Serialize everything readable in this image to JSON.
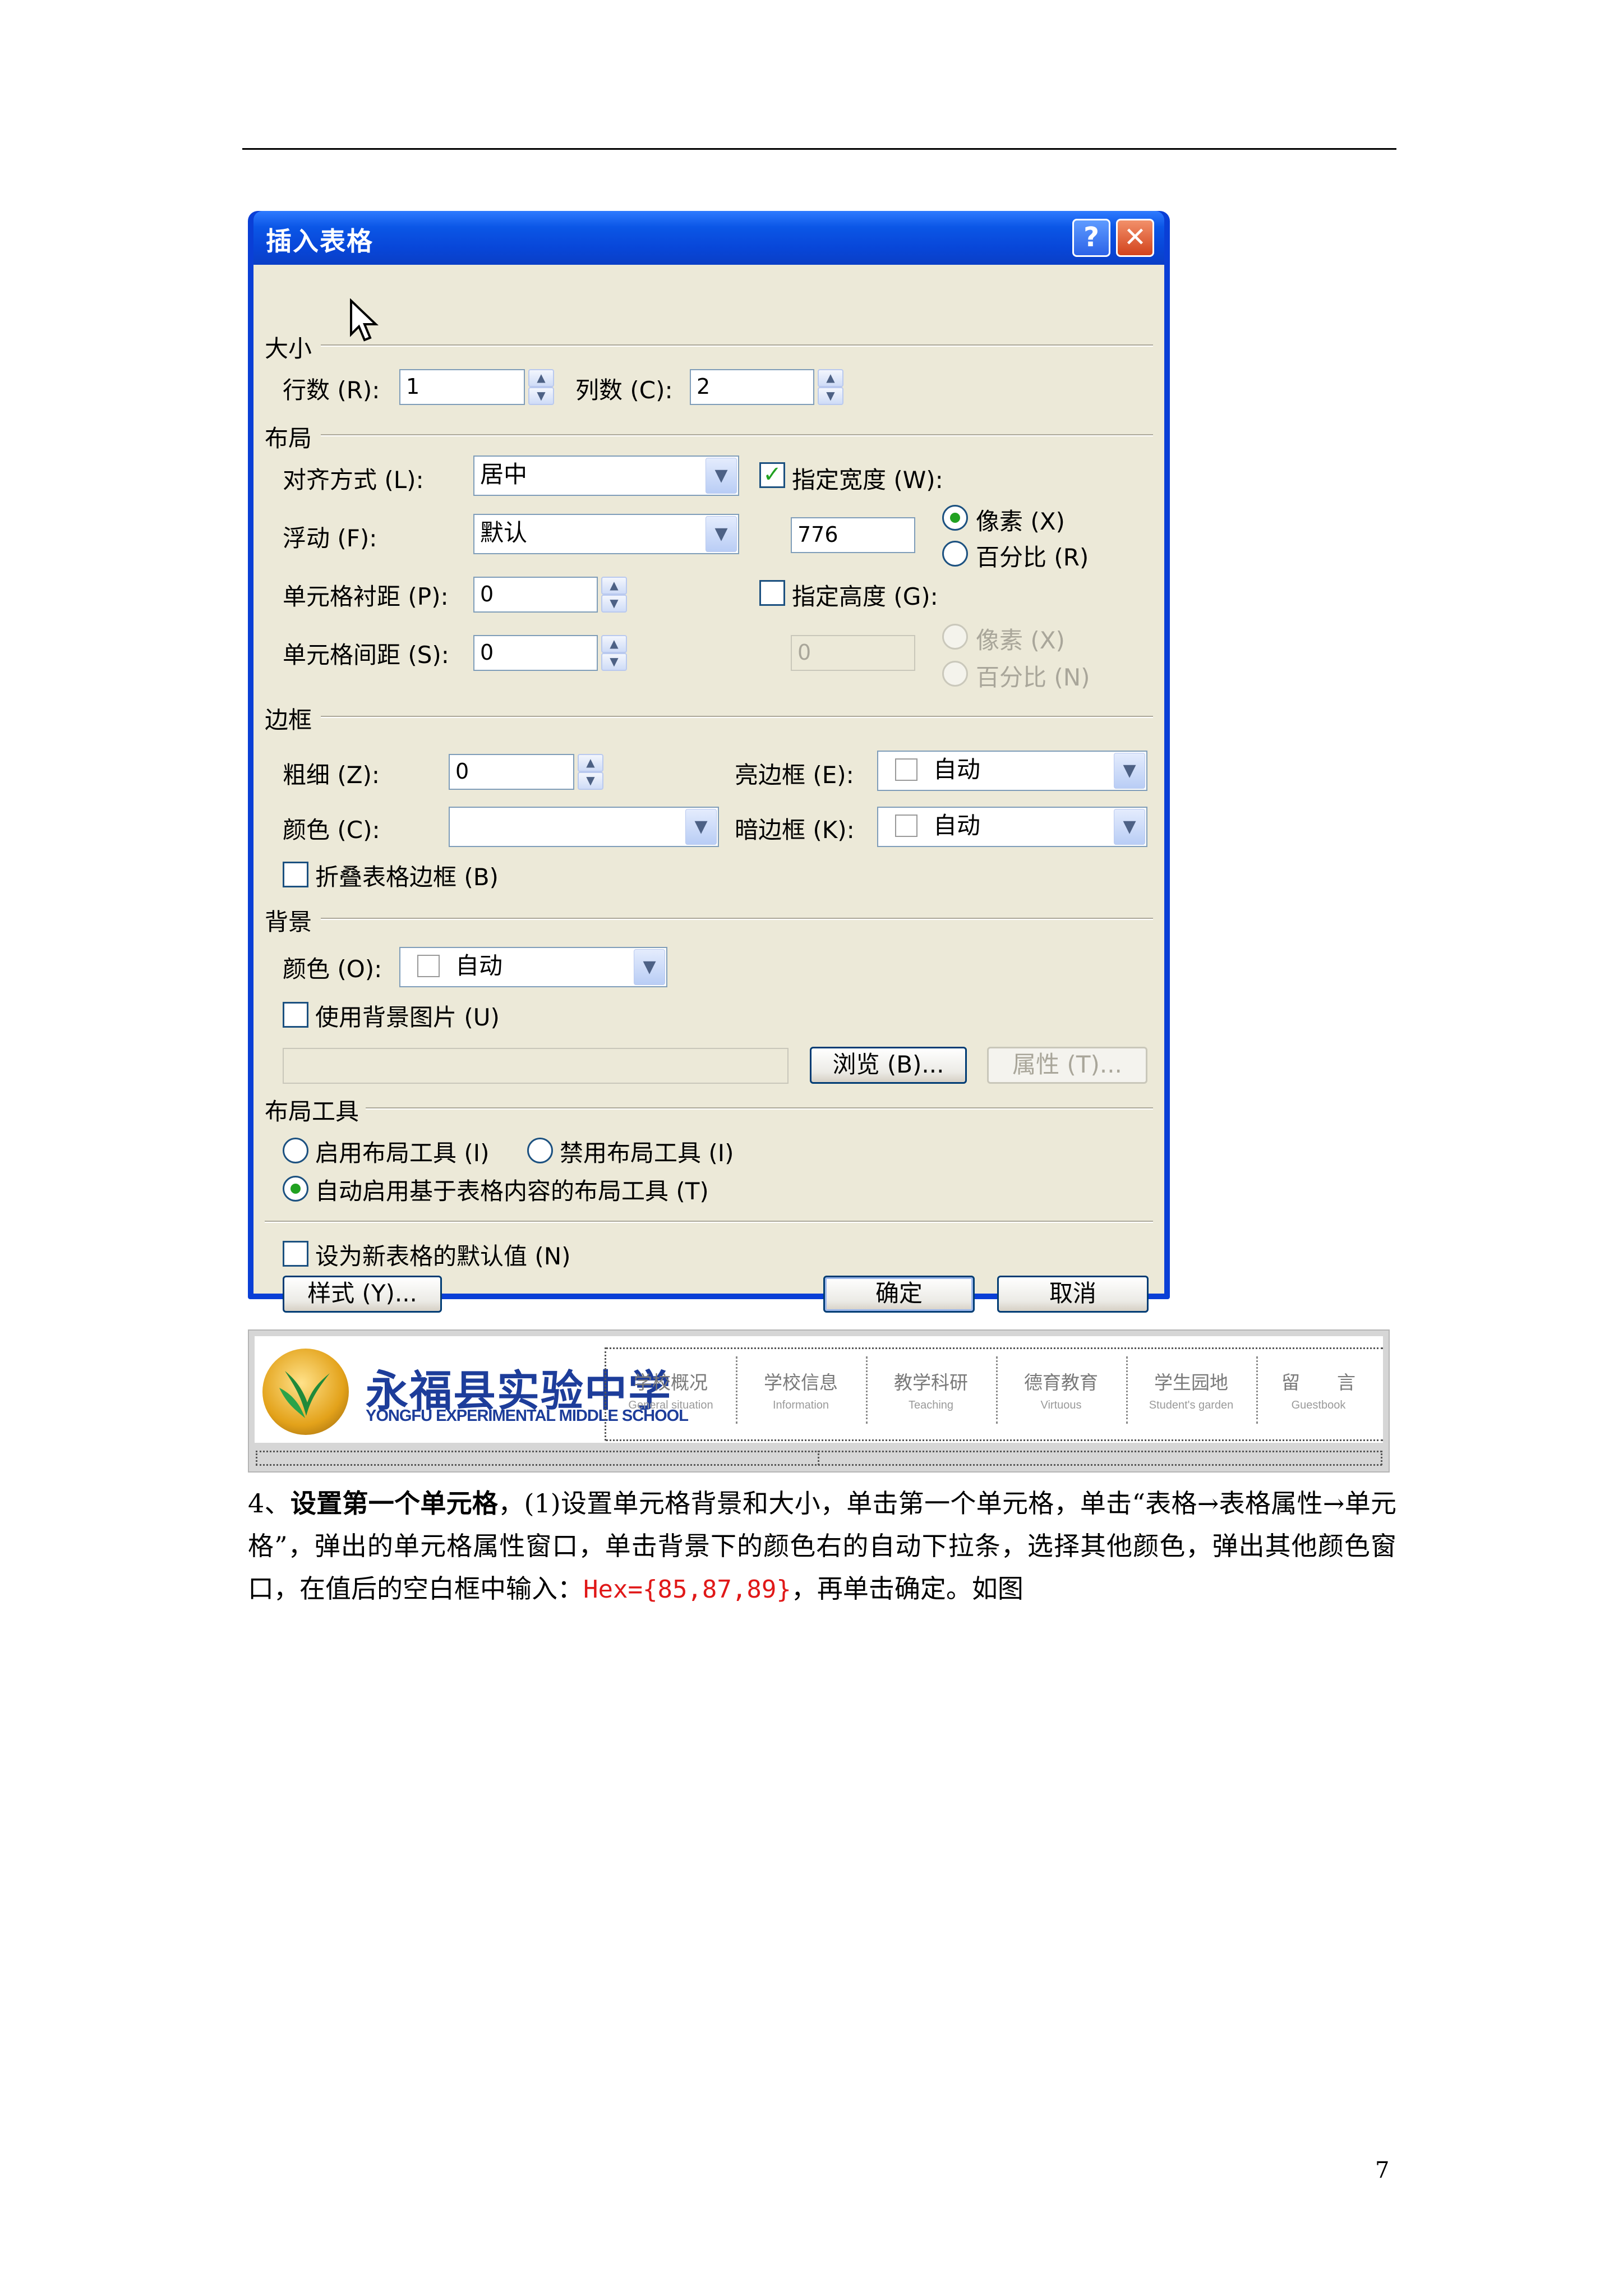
{
  "dialog": {
    "title": "插入表格",
    "help_glyph": "?",
    "close_glyph": "✕",
    "sections": {
      "size": "大小",
      "layout": "布局",
      "border": "边框",
      "background": "背景",
      "layout_tools": "布局工具"
    },
    "size": {
      "rows_label": "行数 (R):",
      "rows_value": "1",
      "cols_label": "列数 (C):",
      "cols_value": "2"
    },
    "layout": {
      "align_label": "对齐方式 (L):",
      "align_value": "居中",
      "float_label": "浮动 (F):",
      "float_value": "默认",
      "padding_label": "单元格衬距 (P):",
      "padding_value": "0",
      "spacing_label": "单元格间距 (S):",
      "spacing_value": "0",
      "width_check_label": "指定宽度 (W):",
      "width_checked": true,
      "width_value": "776",
      "width_unit_px": "像素 (X)",
      "width_unit_pct": "百分比 (R)",
      "height_check_label": "指定高度 (G):",
      "height_checked": false,
      "height_value": "0",
      "height_unit_px": "像素 (X)",
      "height_unit_pct": "百分比 (N)"
    },
    "border": {
      "thickness_label": "粗细 (Z):",
      "thickness_value": "0",
      "color_label": "颜色 (C):",
      "light_label": "亮边框 (E):",
      "light_value": "自动",
      "dark_label": "暗边框 (K):",
      "dark_value": "自动",
      "collapse_label": "折叠表格边框 (B)"
    },
    "background": {
      "color_label": "颜色 (O):",
      "color_value": "自动",
      "use_image_label": "使用背景图片 (U)",
      "browse_label": "浏览 (B)...",
      "properties_label": "属性 (T)..."
    },
    "layout_tools": {
      "enable": "启用布局工具 (I)",
      "disable": "禁用布局工具 (I)",
      "auto": "自动启用基于表格内容的布局工具 (T)"
    },
    "default_label": "设为新表格的默认值 (N)",
    "style_button": "样式 (Y)...",
    "ok_button": "确定",
    "cancel_button": "取消"
  },
  "banner": {
    "school_cn": "永福县实验中学",
    "school_en": "YONGFU EXPERIMENTAL MIDDLE SCHOOL",
    "nav": [
      {
        "cn": "学校概况",
        "en": "General  situation"
      },
      {
        "cn": "学校信息",
        "en": "Information"
      },
      {
        "cn": "教学科研",
        "en": "Teaching"
      },
      {
        "cn": "德育教育",
        "en": "Virtuous"
      },
      {
        "cn": "学生园地",
        "en": "Student's  garden"
      },
      {
        "cn": "留　　言",
        "en": "Guestbook"
      }
    ]
  },
  "paragraph": {
    "number": "4、",
    "bold": "设置第一个单元格",
    "text1": "，(1)设置单元格背景和大小，单击第一个单元格，单击“表格→表格属性→单元格”，弹出的单元格属性窗口，单击背景下的颜色右的自动下拉条，选择其他颜色，弹出其他颜色窗口，在值后的空白框中输入：",
    "hex": "Hex={85,87,89}",
    "text2": "，再单击确定。如图"
  },
  "page_number": "7",
  "colors": {
    "title_bar": "#0846d8",
    "dialog_face": "#ece9d8",
    "hex_text": "#e01818",
    "logo_text": "#1d3d9a"
  }
}
